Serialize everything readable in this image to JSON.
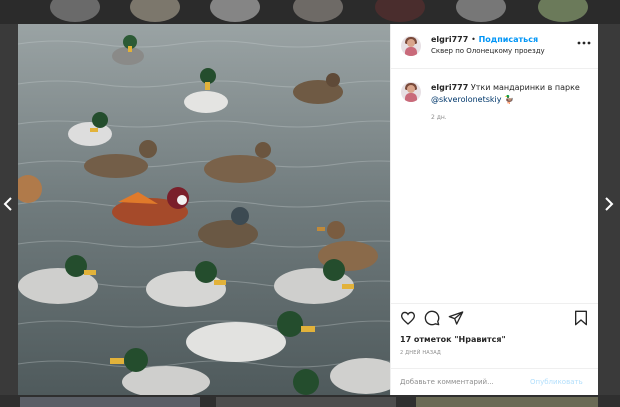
{
  "post": {
    "username": "elgri777",
    "separator": "•",
    "follow_label": "Подписаться",
    "location": "Сквер по Олонецкому проезду",
    "more_icon": "more-options-icon",
    "caption_user": "elgri777",
    "caption_text": "Утки мандаринки в парке",
    "caption_mention": "@skverolonetskiy",
    "caption_emoji": "🦆",
    "time_ago": "2 дн.",
    "likes": "17 отметок \"Нравится\"",
    "posted_ago": "2 ДНЕЙ НАЗАД",
    "comment_placeholder": "Добавьте комментарий...",
    "publish_label": "Опубликовать"
  },
  "icons": {
    "like": "heart-icon",
    "comment": "comment-icon",
    "share": "share-icon",
    "save": "bookmark-icon",
    "prev": "chevron-left-icon",
    "next": "chevron-right-icon"
  },
  "colors": {
    "link": "#0095f6",
    "publish_disabled": "#b2dffc",
    "water": "#6f7a7c"
  }
}
